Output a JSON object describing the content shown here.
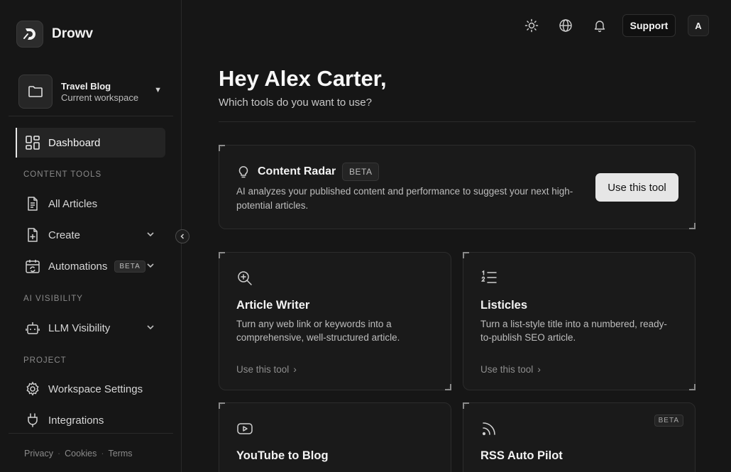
{
  "brand": {
    "name": "Drowv",
    "logo_icon": "drowv-logo-icon"
  },
  "workspace": {
    "name": "Travel Blog",
    "subtitle": "Current workspace"
  },
  "nav": {
    "dashboard": "Dashboard",
    "section_content_tools": "CONTENT TOOLS",
    "all_articles": "All Articles",
    "create": "Create",
    "automations": "Automations",
    "automations_badge": "BETA",
    "section_ai_visibility": "AI VISIBILITY",
    "llm_visibility": "LLM Visibility",
    "section_project": "PROJECT",
    "workspace_settings": "Workspace Settings",
    "integrations": "Integrations"
  },
  "footer": {
    "privacy": "Privacy",
    "cookies": "Cookies",
    "terms": "Terms",
    "separator": "·"
  },
  "topbar": {
    "support": "Support",
    "avatar_initial": "A"
  },
  "main": {
    "greeting": "Hey Alex Carter,",
    "subtitle": "Which tools do you want to use?"
  },
  "featured_tool": {
    "title": "Content Radar",
    "badge": "BETA",
    "description": "AI analyzes your published content and performance to suggest your next high-potential articles.",
    "button": "Use this tool"
  },
  "tools": [
    {
      "title": "Article Writer",
      "description": "Turn any web link or keywords into a comprehensive, well-structured article.",
      "link": "Use this tool",
      "icon": "magnifier-plus-icon"
    },
    {
      "title": "Listicles",
      "description": "Turn a list-style title into a numbered, ready-to-publish SEO article.",
      "link": "Use this tool",
      "icon": "numbered-list-icon"
    },
    {
      "title": "YouTube to Blog",
      "description": "",
      "link": "",
      "icon": "youtube-icon"
    },
    {
      "title": "RSS Auto Pilot",
      "description": "",
      "link": "",
      "icon": "rss-icon",
      "badge": "BETA"
    }
  ],
  "colors": {
    "background": "#161616",
    "card": "#1a1a1a",
    "button_light": "#e6e6e6",
    "text": "#f3f3f3",
    "muted": "#bdbdbd"
  }
}
